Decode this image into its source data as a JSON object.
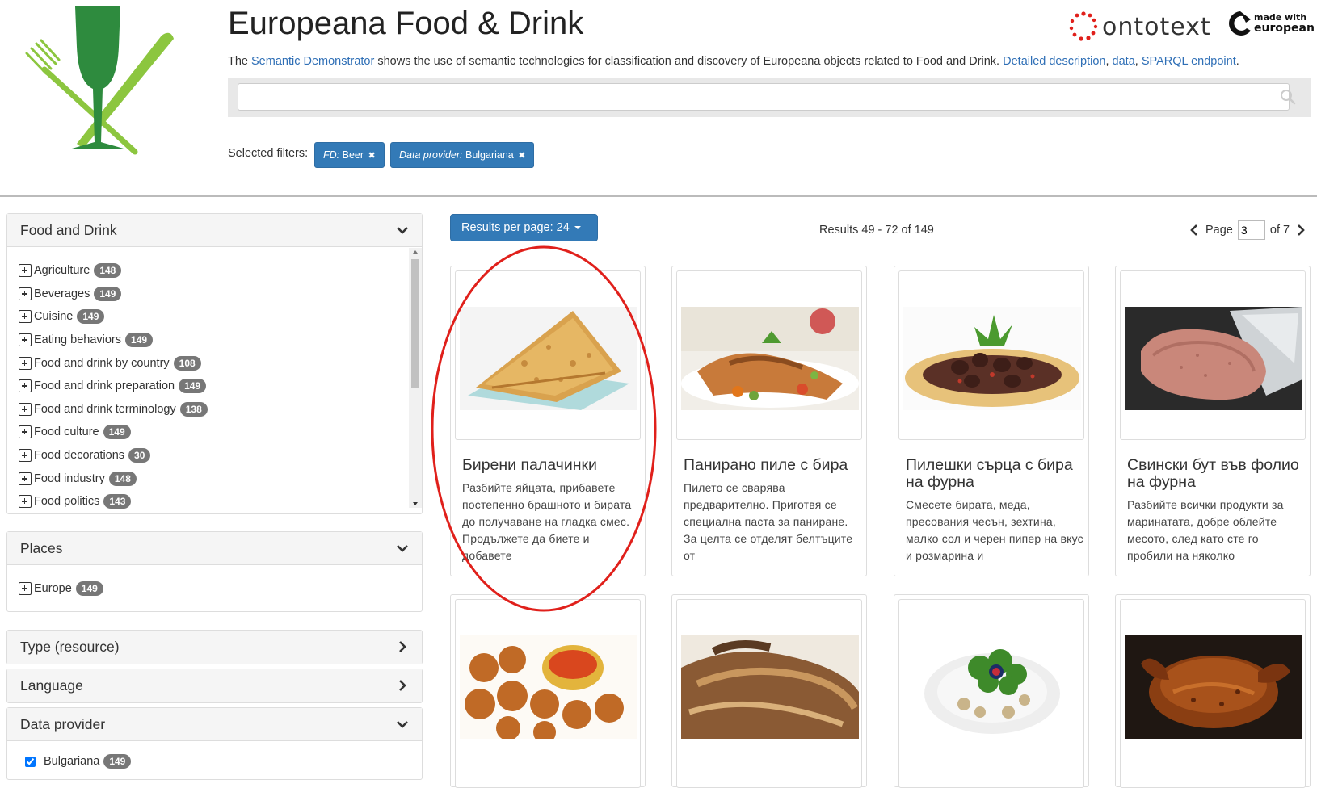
{
  "header": {
    "title": "Europeana Food & Drink",
    "intro": {
      "prefix": "The ",
      "link_semantic": "Semantic Demonstrator",
      "middle": " shows the use of semantic technologies for classification and discovery of Europeana objects related to Food and Drink. ",
      "link_detailed": "Detailed description",
      "sep1": ", ",
      "link_data": "data",
      "sep2": ", ",
      "link_sparql": "SPARQL endpoint",
      "suffix": "."
    },
    "partner_logos": [
      "ontotext",
      "made with europeana"
    ],
    "search": {
      "value": "",
      "placeholder": ""
    },
    "selected_filters_label": "Selected filters:",
    "filters": [
      {
        "key": "FD:",
        "value": " Beer"
      },
      {
        "key": "Data provider:",
        "value": " Bulgariana"
      }
    ]
  },
  "sidebar": {
    "food_and_drink": {
      "title": "Food and Drink",
      "items": [
        {
          "label": "Agriculture",
          "count": "148"
        },
        {
          "label": "Beverages",
          "count": "149"
        },
        {
          "label": "Cuisine",
          "count": "149"
        },
        {
          "label": "Eating behaviors",
          "count": "149"
        },
        {
          "label": "Food and drink by country",
          "count": "108"
        },
        {
          "label": "Food and drink preparation",
          "count": "149"
        },
        {
          "label": "Food and drink terminology",
          "count": "138"
        },
        {
          "label": "Food culture",
          "count": "149"
        },
        {
          "label": "Food decorations",
          "count": "30"
        },
        {
          "label": "Food industry",
          "count": "148"
        },
        {
          "label": "Food politics",
          "count": "143"
        }
      ]
    },
    "places": {
      "title": "Places",
      "items": [
        {
          "label": "Europe",
          "count": "149"
        }
      ]
    },
    "type_resource": {
      "title": "Type (resource)"
    },
    "language": {
      "title": "Language"
    },
    "data_provider": {
      "title": "Data provider",
      "items": [
        {
          "label": "Bulgariana",
          "count": "149",
          "checked": true
        }
      ]
    }
  },
  "toolbar": {
    "results_per_page": "Results per page: 24",
    "results_count": "Results 49 - 72 of 149",
    "page_label": "Page",
    "page_value": "3",
    "page_of": "of 7"
  },
  "results": [
    {
      "title": "Бирени палачинки",
      "desc": "Разбийте яйцата, прибавете постепенно брашното и бирата до получаване на гладка смес. Продължете да биете и добавете",
      "highlighted": true,
      "image": "crepes"
    },
    {
      "title": "Панирано пиле с бира",
      "desc": "Пилето се сварява предварително. Приготвя се специална паста за паниране. За целта се отделят белтъците от",
      "image": "breaded-chicken"
    },
    {
      "title": "Пилешки сърца с бира на фурна",
      "desc": "Смесете бирата, меда, пресования чесън, зехтина, малко сол и черен пипер на вкус и розмарина и",
      "image": "chicken-hearts"
    },
    {
      "title": "Свински бут във фолио на фурна",
      "desc": "Разбийте всички продукти за маринатата, добре облейте месото, след като сте го пробили на няколко",
      "image": "pork-leg"
    },
    {
      "title": "",
      "desc": "",
      "image": "meatballs"
    },
    {
      "title": "",
      "desc": "",
      "image": "roast-meat"
    },
    {
      "title": "",
      "desc": "",
      "image": "salad-plate"
    },
    {
      "title": "",
      "desc": "",
      "image": "roast-chicken"
    }
  ],
  "colors": {
    "primary": "#337ab7",
    "link": "#2f6fb6",
    "badge": "#777777",
    "highlight_circle": "#e0201b",
    "logo_green_dark": "#2e8b3e",
    "logo_green_light": "#8cc63f"
  }
}
